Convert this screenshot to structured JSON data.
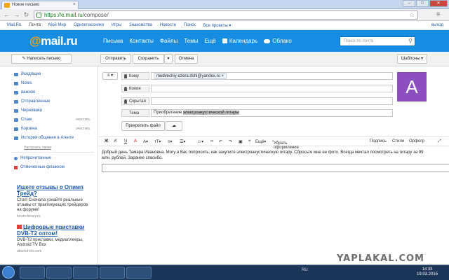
{
  "browser": {
    "tab_title": "Новое письмо",
    "url_host": "https://e.mail.ru",
    "url_path": "/compose/",
    "window_controls": {
      "minimize": "–",
      "maximize": "□",
      "close": "✕"
    }
  },
  "portal_nav": {
    "items": [
      "Mail.Ru",
      "Почта",
      "Мой Мир",
      "Одноклассники",
      "Игры",
      "Знакомства",
      "Новости",
      "Поиск",
      "Все проекты ▾"
    ],
    "right": "выход"
  },
  "header": {
    "logo_at": "@",
    "logo_text": "mail.ru",
    "nav": [
      "Письма",
      "Контакты",
      "Файлы",
      "Темы",
      "Ещё"
    ],
    "calendar": "Календарь",
    "cloud": "Облако",
    "search_placeholder": "Поиск по почте"
  },
  "toolbar": {
    "compose": "Написать письмо",
    "send": "Отправить",
    "save": "Сохранить",
    "cancel": "Отмена",
    "templates": "Шаблоны"
  },
  "sidebar": {
    "folders": [
      {
        "label": "Входящие",
        "action": ""
      },
      {
        "label": "Notes",
        "action": ""
      },
      {
        "label": "важное",
        "action": ""
      },
      {
        "label": "Отправленные",
        "action": ""
      },
      {
        "label": "Черновики",
        "action": ""
      },
      {
        "label": "Спам",
        "action": "очистить"
      },
      {
        "label": "Корзина",
        "action": "очистить"
      },
      {
        "label": "История общения в Агенте",
        "action": ""
      }
    ],
    "settings_link": "Настроить папки",
    "marks": [
      "Непрочитанные",
      "Отмеченные флажком"
    ],
    "ads": [
      {
        "title": "Ищете отзывы о Олимп Трейд?",
        "text": "Стоп! Сначала узнайте реальные отзывы от практикующих трейдеров на форуме!",
        "source": "forum-binary.ru"
      },
      {
        "title": "Цифровые приставки DVB-T2 оптом!",
        "text": "DVB-T2 приставки, медиаплееры, Android TV Box",
        "source": "absolut-tds.com"
      }
    ]
  },
  "compose": {
    "to_label": "Кому",
    "to_value": "medvechiy-ozera.dshi@yandex.ru",
    "cc_label": "Копия",
    "bcc_label": "Скрытая",
    "subject_label": "Тема",
    "subject_plain": "Приобретение",
    "subject_hl": "электроакустической гитары",
    "attach": "Прикрепить файл",
    "avatar_letter": "А",
    "format": {
      "bold": "Ж",
      "italic": "К",
      "underline": "Ч",
      "color": "А",
      "remove_format": "Убрать оформление",
      "signature": "Подпись",
      "styles": "Стили",
      "spell": "Орфогр"
    },
    "body": "Добрый день Тамара Ивановна. Могу я Вас попросить: как закупите  электроакустическую гитару. Сбросьте мне ее фото. Всегда мечтал посмотреть на гитару за 99 млн. рублей. Заранее спасибо."
  },
  "taskbar": {
    "tray": "RU",
    "time": "14:33",
    "date": "19.03.2015"
  },
  "watermark": "YAPLAKAL.COM",
  "colors": {
    "header": "#168de2",
    "logo_accent": "#f9a21b",
    "avatar": "#8c4fbf",
    "link": "#1e5baa"
  }
}
